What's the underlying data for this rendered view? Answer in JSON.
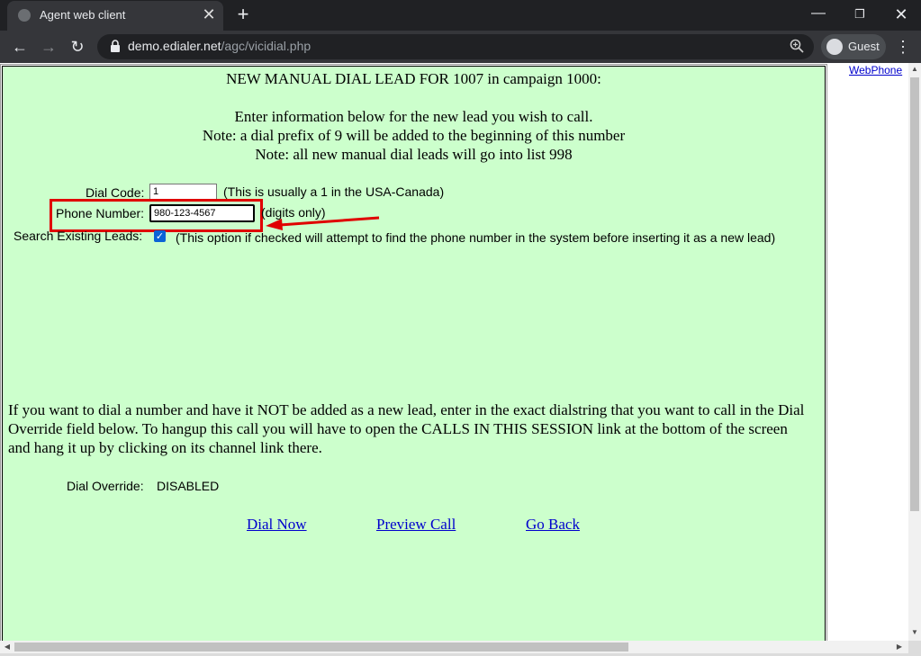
{
  "browser": {
    "tab_title": "Agent web client",
    "url_host": "demo.edialer.net",
    "url_path": "/agc/vicidial.php",
    "profile_label": "Guest",
    "icons": {
      "tab": "globe-icon",
      "close": "close-icon",
      "new_tab": "plus-icon",
      "back": "arrow-left-icon",
      "forward": "arrow-right-icon",
      "reload": "reload-icon",
      "lock": "lock-icon",
      "zoom": "zoom-icon",
      "avatar": "avatar-icon",
      "menu": "kebab-menu-icon"
    }
  },
  "form": {
    "heading": "NEW MANUAL DIAL LEAD FOR 1007 in campaign 1000:",
    "instructions": [
      "Enter information below for the new lead you wish to call.",
      "Note: a dial prefix of 9 will be added to the beginning of this number",
      "Note: all new manual dial leads will go into list 998"
    ],
    "dial_code": {
      "label": "Dial Code:",
      "value": "1",
      "hint": "(This is usually a 1 in the USA-Canada)"
    },
    "phone_number": {
      "label": "Phone Number:",
      "value": "980-123-4567",
      "hint": "(digits only)"
    },
    "search_existing": {
      "label": "Search Existing Leads:",
      "checked": true,
      "hint": "(This option if checked will attempt to find the phone number in the system before inserting it as a new lead)"
    },
    "override_instructions": "If you want to dial a number and have it NOT be added as a new lead, enter in the exact dialstring that you want to call in the Dial Override field below. To hangup this call you will have to open the CALLS IN THIS SESSION link at the bottom of the screen and hang it up by clicking on its channel link there.",
    "dial_override": {
      "label": "Dial Override:",
      "value": "DISABLED"
    },
    "links": {
      "dial_now": "Dial Now",
      "preview_call": "Preview Call",
      "go_back": "Go Back"
    }
  },
  "sidebar": {
    "webphone_link": "WebPhone"
  },
  "colors": {
    "panel_bg": "#ccffcc",
    "highlight": "#e00000",
    "link": "#0000cc",
    "checkbox": "#0b63d6"
  }
}
